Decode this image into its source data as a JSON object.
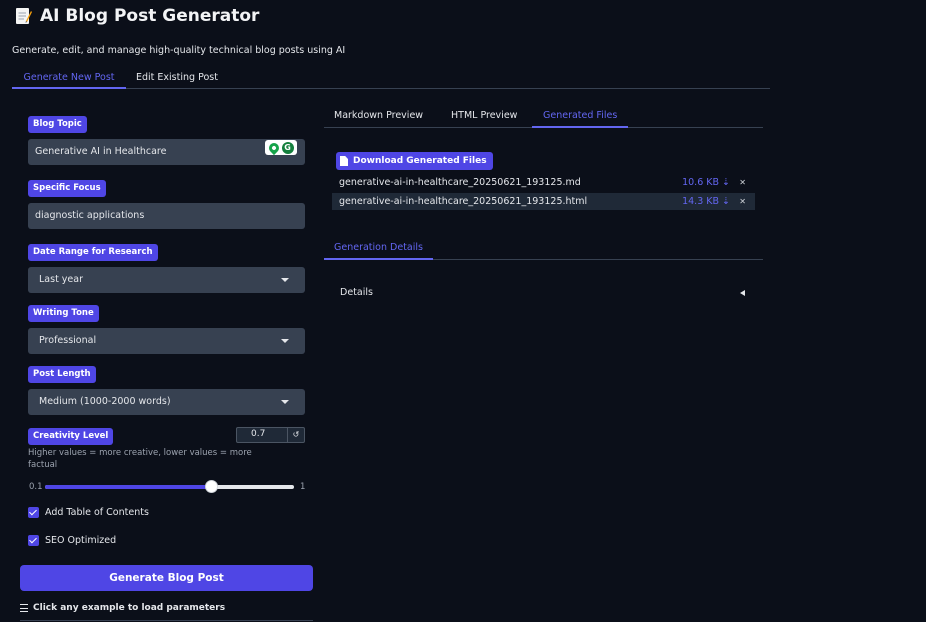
{
  "app": {
    "title": "AI Blog Post Generator",
    "subtitle": "Generate, edit, and manage high-quality technical blog posts using AI"
  },
  "main_tabs": [
    {
      "label": "Generate New Post",
      "active": true
    },
    {
      "label": "Edit Existing Post",
      "active": false
    }
  ],
  "form": {
    "blog_topic": {
      "label": "Blog Topic",
      "value": "Generative AI in Healthcare"
    },
    "specific_focus": {
      "label": "Specific Focus",
      "value": "diagnostic applications"
    },
    "date_range": {
      "label": "Date Range for Research",
      "value": "Last year"
    },
    "writing_tone": {
      "label": "Writing Tone",
      "value": "Professional"
    },
    "post_length": {
      "label": "Post Length",
      "value": "Medium (1000-2000 words)"
    },
    "creativity": {
      "label": "Creativity Level",
      "value": "0.7",
      "hint": "Higher values = more creative, lower values = more factual",
      "min": "0.1",
      "max": "1",
      "level": 0.7
    },
    "toc": {
      "label": "Add Table of Contents",
      "checked": true
    },
    "seo": {
      "label": "SEO Optimized",
      "checked": true
    },
    "generate_label": "Generate Blog Post",
    "examples_hint": "Click any example to load parameters"
  },
  "right_tabs": [
    {
      "label": "Markdown Preview",
      "active": false
    },
    {
      "label": "HTML Preview",
      "active": false
    },
    {
      "label": "Generated Files",
      "active": true
    }
  ],
  "files": {
    "download_label": "Download Generated Files",
    "items": [
      {
        "name": "generative-ai-in-healthcare_20250621_193125.md",
        "size": "10.6 KB ⇣"
      },
      {
        "name": "generative-ai-in-healthcare_20250621_193125.html",
        "size": "14.3 KB ⇣"
      }
    ]
  },
  "details": {
    "tab_label": "Generation Details",
    "accordion_label": "Details"
  },
  "colors": {
    "accent": "#4f46e5",
    "background": "#0b0f19",
    "field": "#374151"
  }
}
